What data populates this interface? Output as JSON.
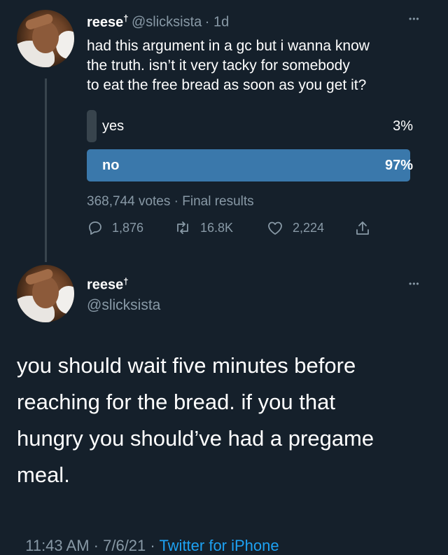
{
  "original_tweet": {
    "display_name": "reese",
    "name_suffix": "†",
    "handle": "@slicksista",
    "time": "· 1d",
    "more": "•••",
    "text_lines": [
      "had this argument in a gc but i wanna know",
      "the truth. isn’t it very tacky for somebody",
      "to eat the free bread as soon as you get it?"
    ],
    "poll": {
      "options": [
        {
          "label": "yes",
          "percent_text": "3%",
          "fraction": 0.03,
          "winner": false
        },
        {
          "label": "no",
          "percent_text": "97%",
          "fraction": 0.97,
          "winner": true
        }
      ],
      "summary": "368,744 votes · Final results"
    },
    "actions": {
      "replies": "1,876",
      "retweets": "16.8K",
      "likes": "2,224"
    }
  },
  "reply_tweet": {
    "display_name": "reese",
    "name_suffix": "†",
    "handle": "@slicksista",
    "more": "•••",
    "text_lines": [
      "you should wait five minutes before",
      "reaching for the bread. if you that",
      "hungry you should’ve had a pregame",
      "meal."
    ],
    "timestamp": "11:43 AM · 7/6/21 · ",
    "source": "Twitter for iPhone"
  },
  "colors": {
    "background": "#15202b",
    "muted": "#8899a6",
    "accent": "#1da1f2",
    "poll_winner": "#3a78ab",
    "poll_loser": "#38444d"
  }
}
